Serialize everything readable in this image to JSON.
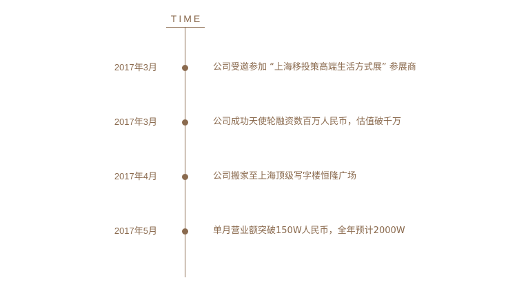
{
  "header": {
    "label": "TIME"
  },
  "colors": {
    "accent": "#8a6a4e",
    "background": "#ffffff"
  },
  "events": [
    {
      "date": "2017年3月",
      "text": "公司受邀参加 “上海移投策高端生活方式展” 参展商"
    },
    {
      "date": "2017年3月",
      "text": "公司成功天使轮融资数百万人民币，估值破千万"
    },
    {
      "date": "2017年4月",
      "text": "公司搬家至上海顶级写字楼恒隆广场"
    },
    {
      "date": "2017年5月",
      "text": "单月营业额突破150W人民币，全年预计2000W"
    }
  ]
}
